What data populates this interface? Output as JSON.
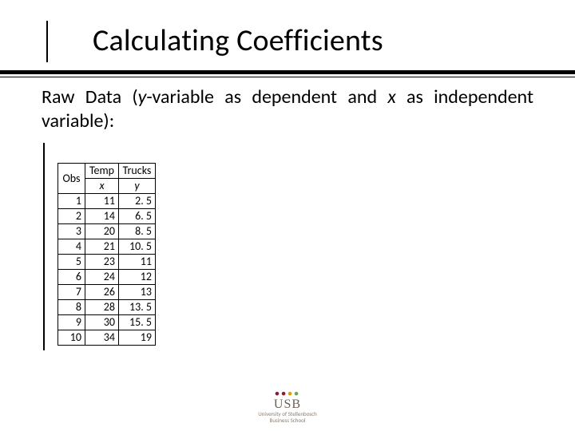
{
  "title": "Calculating Coefficients",
  "subtitle": {
    "pre": "Raw Data (",
    "y": "y",
    "mid1": "-variable as dependent and ",
    "x": "x",
    "mid2": " as independent variable):"
  },
  "table": {
    "headers": {
      "obs": "Obs",
      "temp": "Temp",
      "trucks": "Trucks"
    },
    "subheaders": {
      "x": "x",
      "y": "y"
    },
    "rows": [
      {
        "obs": "1",
        "x": "11",
        "y": "2. 5"
      },
      {
        "obs": "2",
        "x": "14",
        "y": "6. 5"
      },
      {
        "obs": "3",
        "x": "20",
        "y": "8. 5"
      },
      {
        "obs": "4",
        "x": "21",
        "y": "10. 5"
      },
      {
        "obs": "5",
        "x": "23",
        "y": "11"
      },
      {
        "obs": "6",
        "x": "24",
        "y": "12"
      },
      {
        "obs": "7",
        "x": "26",
        "y": "13"
      },
      {
        "obs": "8",
        "x": "28",
        "y": "13. 5"
      },
      {
        "obs": "9",
        "x": "30",
        "y": "15. 5"
      },
      {
        "obs": "10",
        "x": "34",
        "y": "19"
      }
    ]
  },
  "logo": {
    "brand": "USB",
    "line1": "University of Stellenbosch",
    "line2": "Business School"
  },
  "chart_data": {
    "type": "table",
    "title": "Raw Data (y-variable as dependent and x as independent variable)",
    "columns": [
      "Obs",
      "Temp (x)",
      "Trucks (y)"
    ],
    "rows": [
      [
        1,
        11,
        2.5
      ],
      [
        2,
        14,
        6.5
      ],
      [
        3,
        20,
        8.5
      ],
      [
        4,
        21,
        10.5
      ],
      [
        5,
        23,
        11
      ],
      [
        6,
        24,
        12
      ],
      [
        7,
        26,
        13
      ],
      [
        8,
        28,
        13.5
      ],
      [
        9,
        30,
        15.5
      ],
      [
        10,
        34,
        19
      ]
    ]
  }
}
